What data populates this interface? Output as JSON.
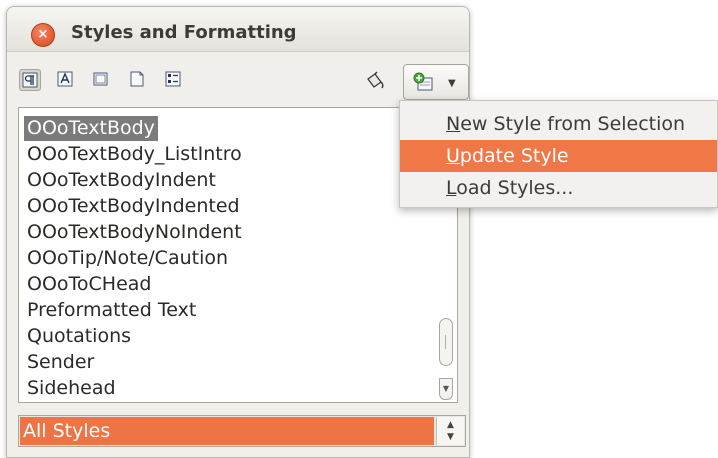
{
  "window": {
    "title": "Styles and Formatting",
    "close_glyph": "×"
  },
  "toolbar": {
    "buttons": [
      {
        "icon": "paragraph-styles-icon",
        "active": true
      },
      {
        "icon": "character-styles-icon",
        "active": false
      },
      {
        "icon": "frame-styles-icon",
        "active": false
      },
      {
        "icon": "page-styles-icon",
        "active": false
      },
      {
        "icon": "list-styles-icon",
        "active": false
      }
    ],
    "fill_format_icon": "fill-format-mode-icon",
    "new_style_icon": "new-style-from-selection-icon",
    "dropdown_caret": "▼"
  },
  "style_list": {
    "items": [
      "OOoTextBody",
      "OOoTextBody_ListIntro",
      "OOoTextBodyIndent",
      "OOoTextBodyIndented",
      "OOoTextBodyNoIndent",
      "OOoTip/Note/Caution",
      "OOoToCHead",
      "Preformatted Text",
      "Quotations",
      "Sender",
      "Sidehead"
    ],
    "selected": "OOoTextBody"
  },
  "filter": {
    "value": "All Styles",
    "spin_up": "▲",
    "spin_down": "▼"
  },
  "menu": {
    "items": [
      {
        "accel": "N",
        "rest": "ew Style from Selection"
      },
      {
        "accel": "U",
        "rest": "pdate Style"
      },
      {
        "accel": "L",
        "rest": "oad Styles..."
      }
    ],
    "highlighted": "Update Style"
  },
  "colors": {
    "accent": "#f07746",
    "selection": "#7b7b7b",
    "window_bg": "#f0efeb"
  }
}
